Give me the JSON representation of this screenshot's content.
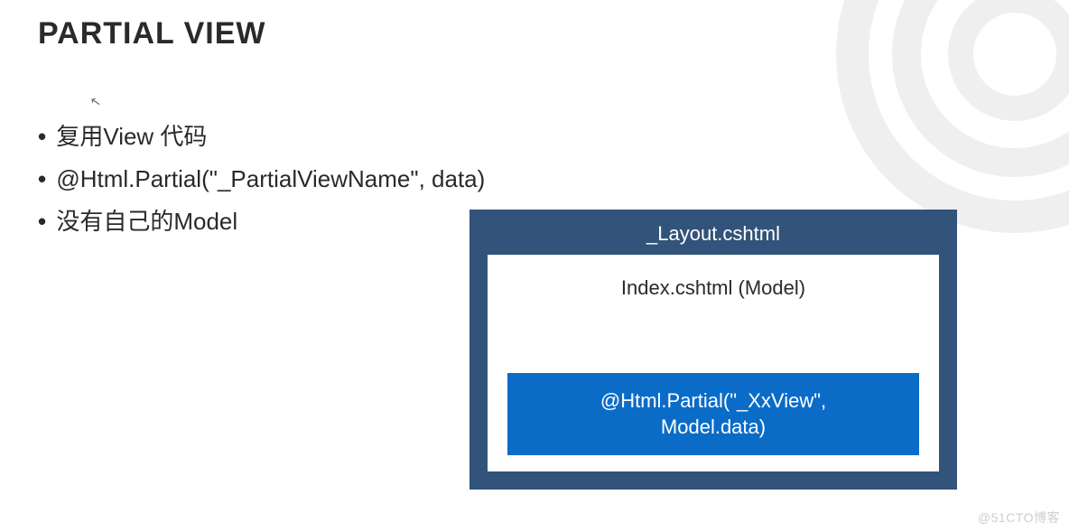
{
  "title": "PARTIAL VIEW",
  "bullets": [
    "复用View 代码",
    "@Html.Partial(\"_PartialViewName\", data)",
    "没有自己的Model"
  ],
  "diagram": {
    "layout_label": "_Layout.cshtml",
    "index_label": "Index.cshtml (Model)",
    "partial_line1": "@Html.Partial(\"_XxView\",",
    "partial_line2": "Model.data)"
  },
  "watermark": "@51CTO博客"
}
